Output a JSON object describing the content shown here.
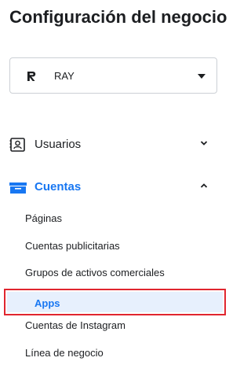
{
  "header": {
    "title": "Configuración del negocio"
  },
  "account": {
    "name": "RAY",
    "logo_icon": "ray-logo-icon"
  },
  "nav": {
    "users": {
      "label": "Usuarios",
      "icon": "user-card-icon",
      "expanded": false
    },
    "accounts": {
      "label": "Cuentas",
      "icon": "folder-icon",
      "expanded": true,
      "items": [
        {
          "label": "Páginas"
        },
        {
          "label": "Cuentas publicitarias"
        },
        {
          "label": "Grupos de activos comerciales"
        },
        {
          "label": "Apps"
        },
        {
          "label": "Cuentas de Instagram"
        },
        {
          "label": "Línea de negocio"
        }
      ]
    }
  },
  "colors": {
    "accent": "#1877f2",
    "highlight_border": "#e0262f",
    "selected_bg": "#e7f0fd"
  }
}
